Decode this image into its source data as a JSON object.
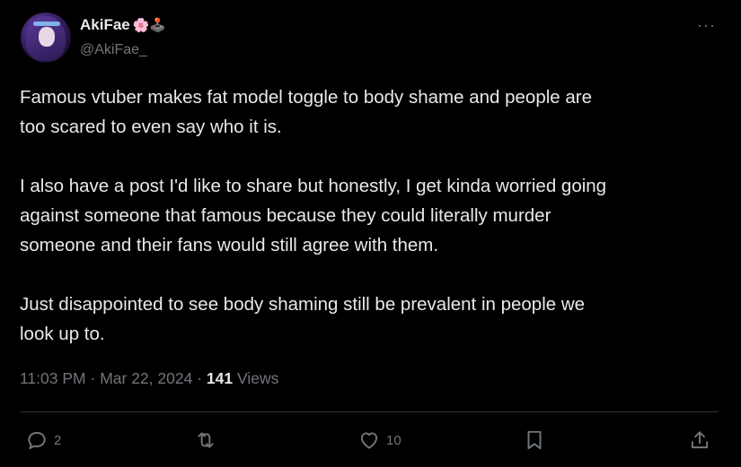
{
  "author": {
    "display_name": "AkiFae",
    "name_emojis": "🌸🕹️",
    "handle": "@AkiFae_"
  },
  "more_icon": "···",
  "tweet": {
    "text": "Famous vtuber makes fat model toggle to body shame and people are\ntoo scared to even say who it is.\n\nI also have a post I'd like to share but honestly, I get kinda worried going\nagainst someone that famous because they could literally murder\nsomeone and their fans would still agree with them.\n\nJust disappointed to see body shaming still be prevalent in people we\nlook up to."
  },
  "meta": {
    "time": "11:03 PM",
    "separator": "·",
    "date": "Mar 22, 2024",
    "views_count": "141",
    "views_label": "Views"
  },
  "actions": {
    "reply_count": "2",
    "repost_count": "",
    "like_count": "10"
  },
  "icons": [
    "reply-icon",
    "repost-icon",
    "like-icon",
    "bookmark-icon",
    "share-icon"
  ]
}
